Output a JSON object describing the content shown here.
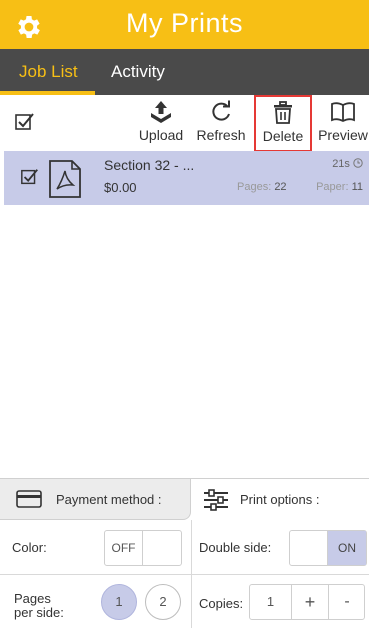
{
  "header": {
    "title": "My Prints"
  },
  "tabs": [
    {
      "label": "Job List",
      "active": true
    },
    {
      "label": "Activity",
      "active": false
    }
  ],
  "toolbar": {
    "upload_label": "Upload",
    "refresh_label": "Refresh",
    "delete_label": "Delete",
    "preview_label": "Preview"
  },
  "job": {
    "title": "Section 32 - ...",
    "cost": "$0.00",
    "time": "21s",
    "pages_label": "Pages:",
    "pages_value": "22",
    "paper_label": "Paper:",
    "paper_value": "11",
    "icon": "pdf-icon",
    "selected": true
  },
  "panels": {
    "payment_label": "Payment method :",
    "print_options_label": "Print options :"
  },
  "options": {
    "color_label": "Color:",
    "color_off": "OFF",
    "color_on": "",
    "double_side_label": "Double side:",
    "double_off": "",
    "double_on": "ON",
    "pages_per_side_line1": "Pages",
    "pages_per_side_line2": "per side:",
    "pages_per_side_1": "1",
    "pages_per_side_2": "2",
    "copies_label": "Copies:",
    "copies_value": "1",
    "copies_plus": "+",
    "copies_minus": "-"
  },
  "colors": {
    "brand_yellow": "#f7bf15",
    "tab_bar": "#4a4a4a",
    "selection": "#c7cbe8",
    "highlight_red": "#e53935"
  }
}
